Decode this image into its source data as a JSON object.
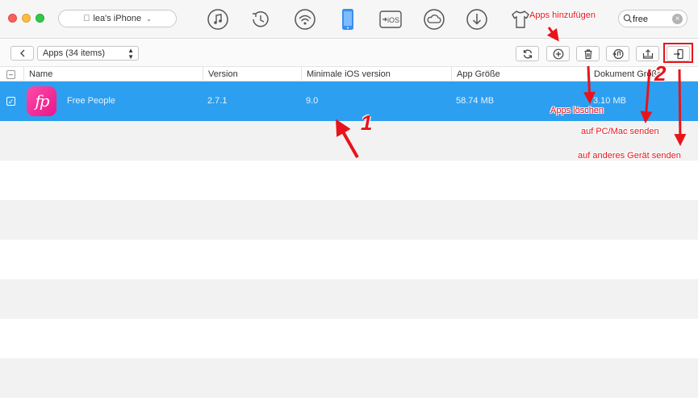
{
  "window": {
    "device_name": "lea's iPhone"
  },
  "toolbar": {
    "icons": [
      "music-icon",
      "history-icon",
      "wifi-icon",
      "iphone-icon",
      "to-ios-icon",
      "cloud-icon",
      "download-icon",
      "tshirt-icon"
    ],
    "ios_label": "iOS"
  },
  "search": {
    "value": "free",
    "placeholder": ""
  },
  "subbar": {
    "category": "Apps (34 items)"
  },
  "table": {
    "columns": [
      "Name",
      "Version",
      "Minimale iOS version",
      "App Größe",
      "Dokument Größe"
    ],
    "rows": [
      {
        "name": "Free People",
        "version": "2.7.1",
        "min_ios": "9.0",
        "app_size": "58.74 MB",
        "doc_size": "3.10 MB",
        "selected": true,
        "icon_text": "fp"
      }
    ]
  },
  "annotations": {
    "add_apps": "Apps hinzufügen",
    "delete_apps": "Apps löschen",
    "send_pc_mac": "auf PC/Mac senden",
    "send_other_device": "auf anderes Gerät senden",
    "num1": "1",
    "num2": "2"
  },
  "colors": {
    "selection": "#2d9ff0",
    "annotation": "#e8141b",
    "device_icon_active": "#3a8ff0"
  }
}
